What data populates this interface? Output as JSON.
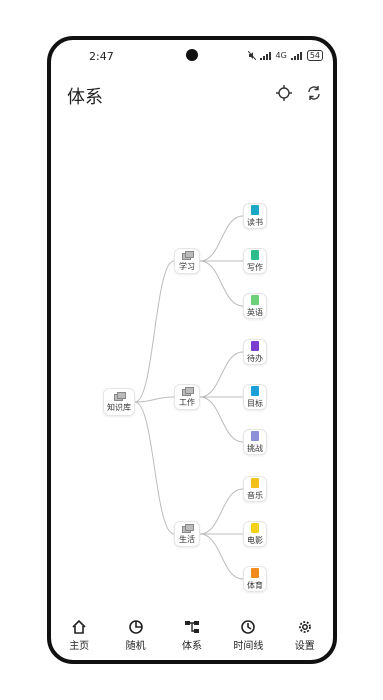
{
  "status": {
    "time": "2:47",
    "net": "4G",
    "battery": "54"
  },
  "appbar": {
    "title": "体系",
    "locate_icon": "crosshair-icon",
    "refresh_icon": "refresh-icon"
  },
  "tree": {
    "root": "知识库",
    "branches": [
      {
        "label": "学习",
        "children": [
          {
            "label": "读书",
            "color": "#1ba8c7"
          },
          {
            "label": "写作",
            "color": "#2dbd8a"
          },
          {
            "label": "英语",
            "color": "#6fd07a"
          }
        ]
      },
      {
        "label": "工作",
        "children": [
          {
            "label": "待办",
            "color": "#7a3fd1"
          },
          {
            "label": "目标",
            "color": "#1a9fd6"
          },
          {
            "label": "挑战",
            "color": "#8a8fd8"
          }
        ]
      },
      {
        "label": "生活",
        "children": [
          {
            "label": "音乐",
            "color": "#f2c21b"
          },
          {
            "label": "电影",
            "color": "#f4d21c"
          },
          {
            "label": "体育",
            "color": "#f08a1e"
          }
        ]
      }
    ]
  },
  "nav": [
    {
      "label": "主页",
      "icon": "home-icon"
    },
    {
      "label": "随机",
      "icon": "random-icon"
    },
    {
      "label": "体系",
      "icon": "hierarchy-icon"
    },
    {
      "label": "时间线",
      "icon": "clock-icon"
    },
    {
      "label": "设置",
      "icon": "gear-icon"
    }
  ]
}
